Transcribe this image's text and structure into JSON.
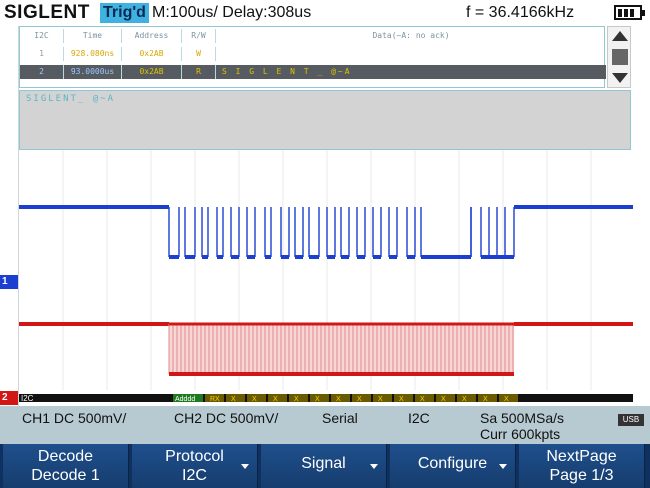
{
  "header": {
    "brand": "SIGLENT",
    "trigger_status": "Trig'd",
    "timebase": "M:100us/ Delay:308us",
    "frequency": "f = 36.4166kHz",
    "battery_icon": "battery-icon"
  },
  "decode_list": {
    "headers": [
      "I2C",
      "Time",
      "Address",
      "R/W",
      "Data(~A: no ack)"
    ],
    "rows": [
      [
        "1",
        "928.080ns",
        "0x2AB",
        "W",
        ""
      ],
      [
        "2",
        "93.0000us",
        "0x2AB",
        "R",
        "S I G L E N T _   @~A"
      ]
    ],
    "scroll_up_icon": "arrow-up-icon",
    "scroll_down_icon": "arrow-down-icon"
  },
  "decoded_text": "SIGLENT_ @~A",
  "waveform": {
    "ch1_color": "#1a3fd1",
    "ch2_color": "#d21515",
    "bus_label": "I2C",
    "bus_first": "Adddd",
    "bus_symbols": [
      "RX",
      "X",
      "X",
      "X",
      "X",
      "X",
      "X",
      "X",
      "X",
      "X",
      "X",
      "X",
      "X",
      "X",
      "X"
    ]
  },
  "markers": {
    "ch1": "1",
    "ch2": "2"
  },
  "status": {
    "ch1": "CH1 DC 500mV/",
    "ch2": "CH2 DC 500mV/",
    "mode": "Serial",
    "protocol": "I2C",
    "sample_rate": "Sa 500MSa/s",
    "curr": "Curr 600kpts",
    "usb_icon": "usb-icon",
    "usb_label": "USB"
  },
  "softkeys": [
    {
      "line1": "Decode",
      "line2": "Decode 1",
      "has_arrow": false
    },
    {
      "line1": "Protocol",
      "line2": "I2C",
      "has_arrow": true
    },
    {
      "line1": "Signal",
      "line2": "",
      "has_arrow": true
    },
    {
      "line1": "Configure",
      "line2": "",
      "has_arrow": true
    },
    {
      "line1": "NextPage",
      "line2": "Page 1/3",
      "has_arrow": false
    }
  ]
}
